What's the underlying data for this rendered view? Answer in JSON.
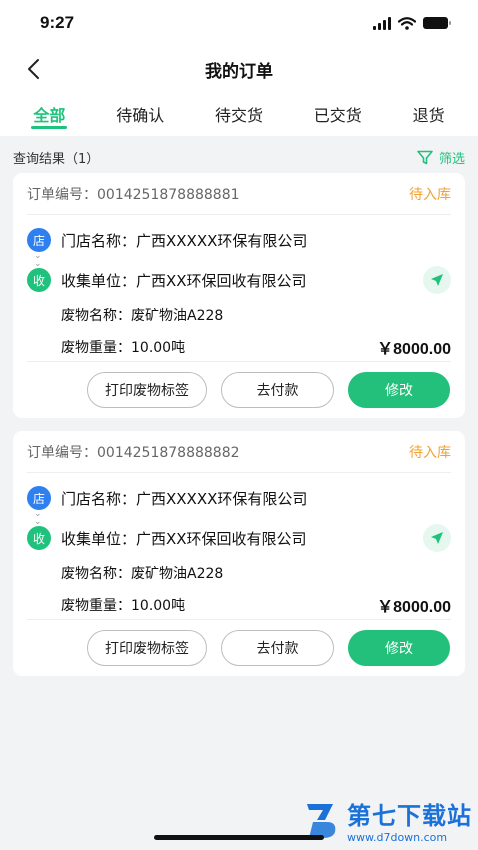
{
  "status_bar": {
    "time": "9:27"
  },
  "nav": {
    "title": "我的订单"
  },
  "tabs": [
    {
      "label": "全部"
    },
    {
      "label": "待确认"
    },
    {
      "label": "待交货"
    },
    {
      "label": "已交货"
    },
    {
      "label": "退货"
    }
  ],
  "result_text": "查询结果（1）",
  "filter_label": "筛选",
  "orders": [
    {
      "order_no": "订单编号：0014251878888881",
      "status": "待入库",
      "store_badge": "店",
      "store": "门店名称：广西XXXXX环保有限公司",
      "collect_badge": "收",
      "collector": "收集单位：广西XX环保回收有限公司",
      "waste_name": "废物名称：废矿物油A228",
      "weight": "废物重量：10.00吨",
      "price": "￥8000.00",
      "btn_print": "打印废物标签",
      "btn_pay": "去付款",
      "btn_edit": "修改"
    },
    {
      "order_no": "订单编号：0014251878888882",
      "status": "待入库",
      "store_badge": "店",
      "store": "门店名称：广西XXXXX环保有限公司",
      "collect_badge": "收",
      "collector": "收集单位：广西XX环保回收有限公司",
      "waste_name": "废物名称：废矿物油A228",
      "weight": "废物重量：10.00吨",
      "price": "￥8000.00",
      "btn_print": "打印废物标签",
      "btn_pay": "去付款",
      "btn_edit": "修改"
    }
  ],
  "watermark": {
    "main": "第七下载站",
    "sub": "www.d7down.com"
  },
  "colors": {
    "accent": "#1ec27d",
    "status_pending": "#f3a132",
    "store_badge": "#2e7ff0"
  }
}
